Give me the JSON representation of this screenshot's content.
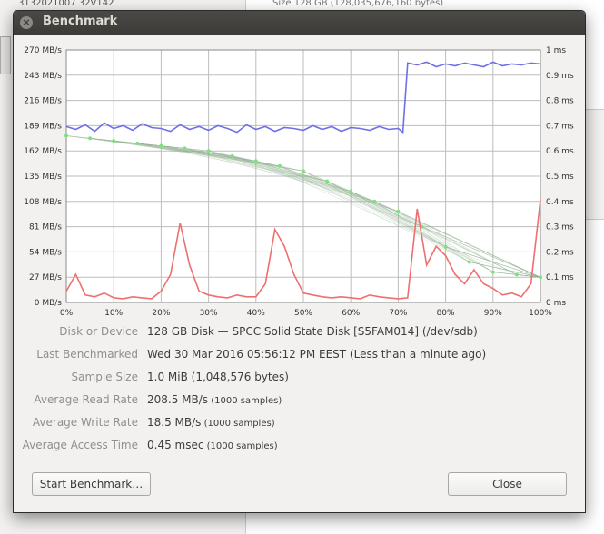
{
  "background": {
    "left_top_text": "3132021007 32V142",
    "right_top_text": "Size      128 GB (128,035,676,160 bytes)"
  },
  "dialog": {
    "title": "Benchmark",
    "close_icon": "close-icon"
  },
  "info": [
    {
      "label": "Disk or Device",
      "value": "128 GB Disk — SPCC Solid State Disk [S5FAM014] (/dev/sdb)",
      "note": ""
    },
    {
      "label": "Last Benchmarked",
      "value": "Wed 30 Mar 2016 05:56:12 PM EEST (Less than a minute ago)",
      "note": ""
    },
    {
      "label": "Sample Size",
      "value": "1.0 MiB (1,048,576 bytes)",
      "note": ""
    },
    {
      "label": "Average Read Rate",
      "value": "208.5 MB/s",
      "note": "(1000 samples)"
    },
    {
      "label": "Average Write Rate",
      "value": "18.5 MB/s",
      "note": "(1000 samples)"
    },
    {
      "label": "Average Access Time",
      "value": "0.45 msec",
      "note": "(1000 samples)"
    }
  ],
  "buttons": {
    "start": "Start Benchmark…",
    "close": "Close"
  },
  "chart_data": {
    "type": "line",
    "grid": true,
    "x_ticks": [
      "0%",
      "10%",
      "20%",
      "30%",
      "40%",
      "50%",
      "60%",
      "70%",
      "80%",
      "90%",
      "100%"
    ],
    "y_left_ticks": [
      "0 MB/s",
      "27 MB/s",
      "54 MB/s",
      "81 MB/s",
      "108 MB/s",
      "135 MB/s",
      "162 MB/s",
      "189 MB/s",
      "216 MB/s",
      "243 MB/s",
      "270 MB/s"
    ],
    "y_right_ticks": [
      "0 ms",
      "0.1 ms",
      "0.2 ms",
      "0.3 ms",
      "0.4 ms",
      "0.5 ms",
      "0.6 ms",
      "0.7 ms",
      "0.8 ms",
      "0.9 ms",
      "1 ms"
    ],
    "ylim_left": [
      0,
      270
    ],
    "ylim_right": [
      0,
      1
    ],
    "colors": {
      "read": "#6f6fe6",
      "write": "#ef6f6f",
      "access": "#7fe07f",
      "access_lines": "#8fb08f"
    },
    "series": [
      {
        "key": "read",
        "x": [
          0,
          2,
          4,
          6,
          8,
          10,
          12,
          14,
          16,
          18,
          20,
          22,
          24,
          26,
          28,
          30,
          32,
          34,
          36,
          38,
          40,
          42,
          44,
          46,
          48,
          50,
          52,
          54,
          56,
          58,
          60,
          62,
          64,
          66,
          68,
          70,
          71,
          72,
          74,
          76,
          78,
          80,
          82,
          84,
          86,
          88,
          90,
          92,
          94,
          96,
          98,
          100
        ],
        "values": [
          188,
          185,
          190,
          183,
          192,
          186,
          189,
          184,
          191,
          187,
          186,
          183,
          190,
          185,
          188,
          184,
          189,
          186,
          182,
          190,
          185,
          188,
          183,
          187,
          186,
          184,
          189,
          185,
          188,
          183,
          187,
          186,
          184,
          188,
          185,
          186,
          182,
          256,
          254,
          257,
          252,
          255,
          253,
          256,
          254,
          252,
          257,
          253,
          255,
          254,
          256,
          255
        ]
      },
      {
        "key": "write",
        "x": [
          0,
          2,
          4,
          6,
          8,
          10,
          12,
          14,
          16,
          18,
          20,
          22,
          24,
          26,
          28,
          30,
          32,
          34,
          36,
          38,
          40,
          42,
          44,
          46,
          48,
          50,
          52,
          54,
          56,
          58,
          60,
          62,
          64,
          66,
          68,
          70,
          72,
          74,
          76,
          78,
          80,
          82,
          84,
          86,
          88,
          90,
          92,
          94,
          96,
          98,
          100
        ],
        "values": [
          12,
          30,
          8,
          6,
          10,
          5,
          4,
          6,
          5,
          4,
          12,
          30,
          85,
          40,
          12,
          8,
          6,
          5,
          8,
          6,
          6,
          20,
          78,
          60,
          30,
          10,
          8,
          6,
          5,
          6,
          5,
          4,
          8,
          6,
          5,
          4,
          5,
          100,
          40,
          60,
          50,
          30,
          20,
          35,
          20,
          15,
          8,
          10,
          6,
          20,
          110
        ]
      },
      {
        "key": "access",
        "x": [
          0,
          5,
          10,
          15,
          20,
          25,
          30,
          35,
          40,
          45,
          50,
          55,
          60,
          65,
          70,
          75,
          80,
          85,
          90,
          95,
          100
        ],
        "values": [
          0.66,
          0.65,
          0.64,
          0.63,
          0.62,
          0.61,
          0.6,
          0.58,
          0.56,
          0.54,
          0.52,
          0.48,
          0.44,
          0.4,
          0.36,
          0.3,
          0.22,
          0.16,
          0.12,
          0.11,
          0.1
        ]
      }
    ]
  }
}
